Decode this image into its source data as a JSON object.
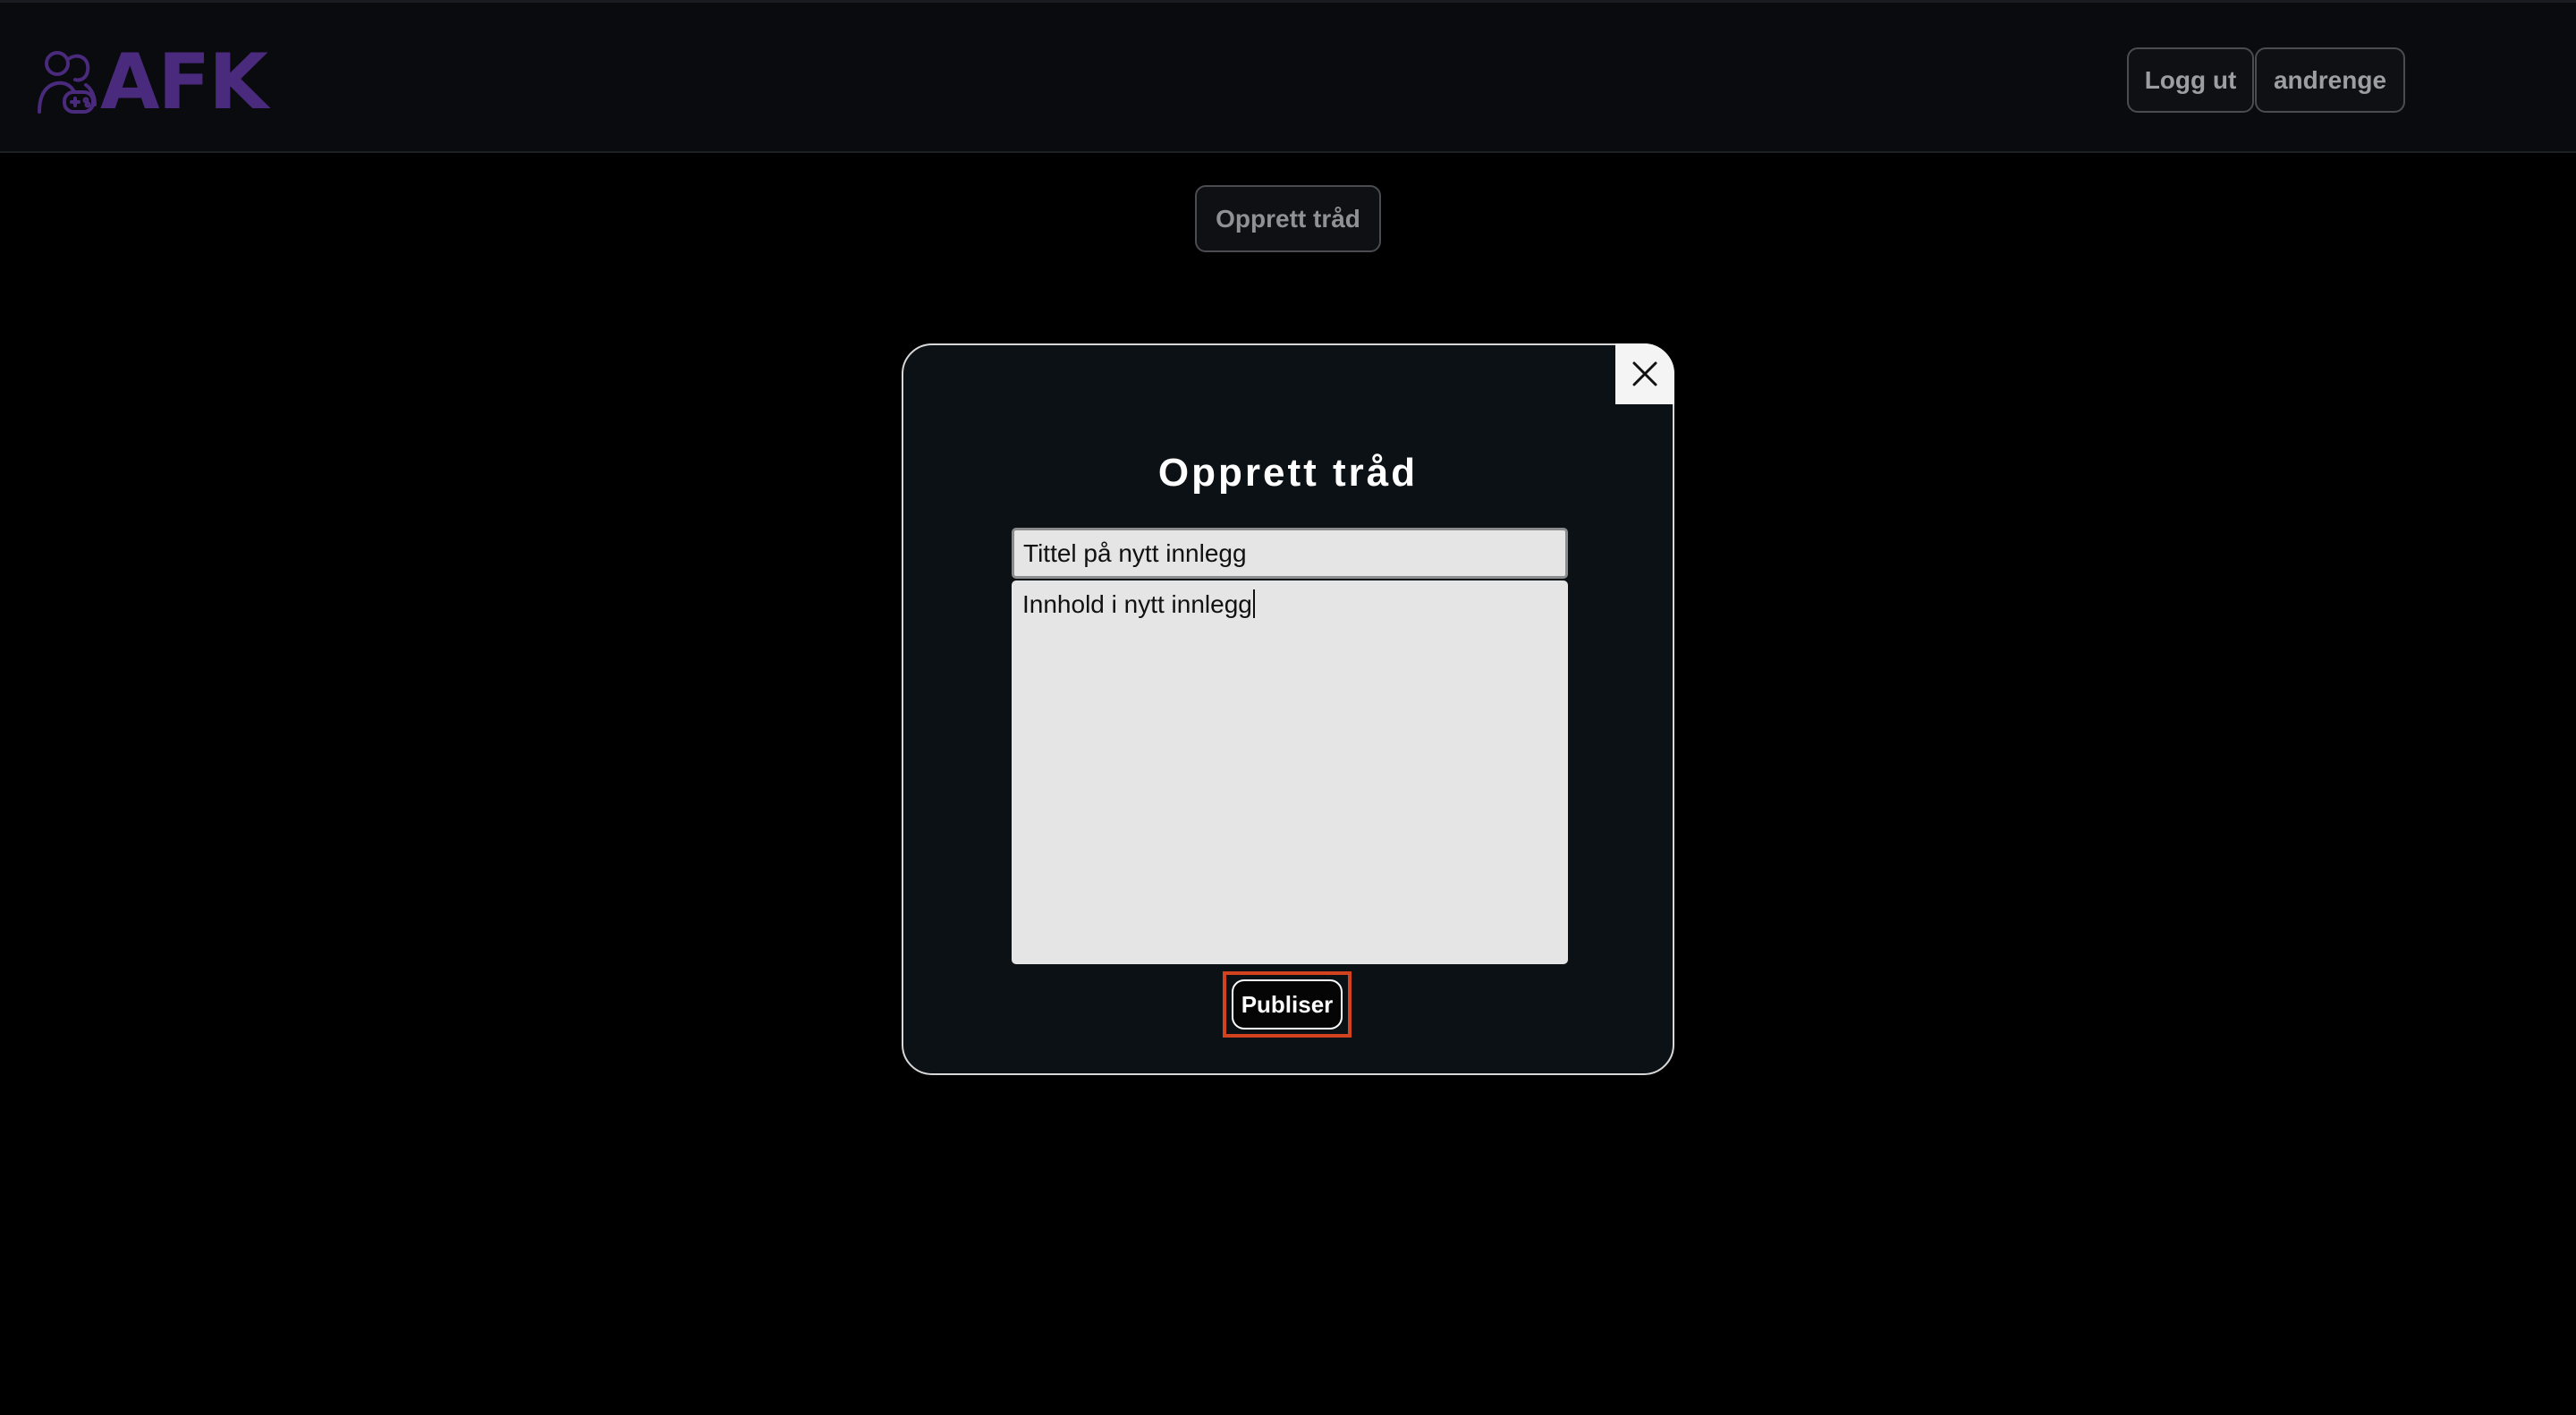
{
  "header": {
    "logo_text": "AFK",
    "logout_label": "Logg ut",
    "username": "andrenge"
  },
  "main": {
    "create_thread_label": "Opprett tråd"
  },
  "modal": {
    "title": "Opprett tråd",
    "title_field_value": "Tittel på nytt innlegg",
    "content_field_value": "Innhold i nytt innlegg",
    "publish_label": "Publiser",
    "close_icon": "close-icon"
  },
  "colors": {
    "brand": "#4a2a7c",
    "focus_ring": "#d2421e",
    "background": "#000000",
    "header_bg": "#0a0b0e",
    "modal_bg": "#0c1115"
  }
}
